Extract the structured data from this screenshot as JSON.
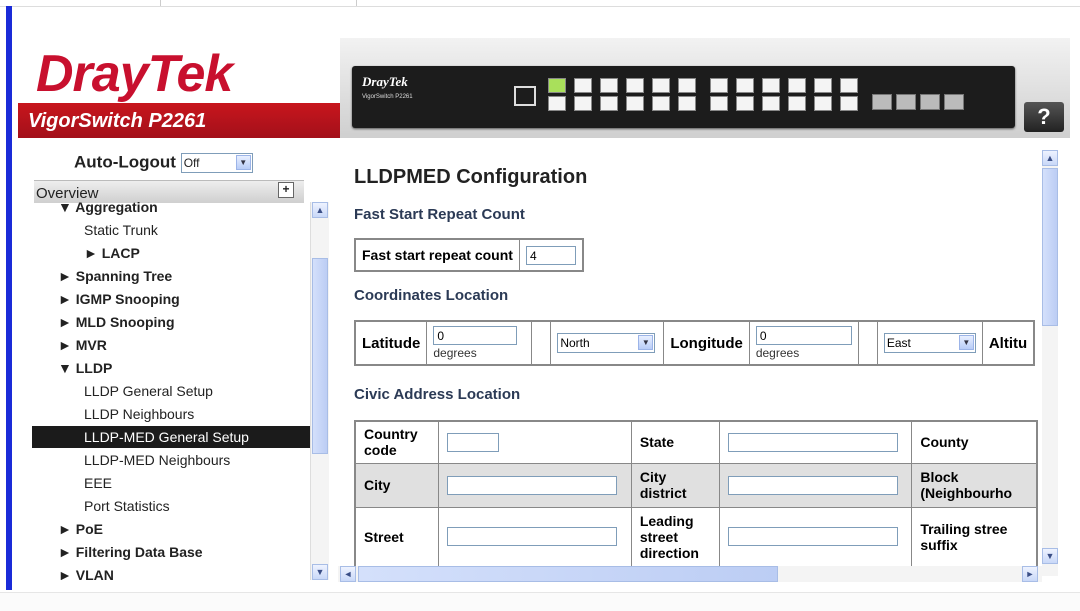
{
  "header": {
    "logo_dray": "Dray",
    "logo_tek": "Tek",
    "model": "VigorSwitch P2261",
    "device_brand": "DrayTek",
    "device_sub": "VigorSwitch P2261",
    "help_label": "?"
  },
  "sidebar": {
    "autologout_label": "Auto-Logout",
    "autologout_value": "Off",
    "overview_label": "Overview",
    "items": [
      {
        "label": "▼ Aggregation",
        "level": "l1"
      },
      {
        "label": "Static Trunk",
        "level": "l2"
      },
      {
        "label": "► LACP",
        "level": "l2b"
      },
      {
        "label": "► Spanning Tree",
        "level": "l1"
      },
      {
        "label": "► IGMP Snooping",
        "level": "l1"
      },
      {
        "label": "► MLD Snooping",
        "level": "l1"
      },
      {
        "label": "► MVR",
        "level": "l1"
      },
      {
        "label": "▼ LLDP",
        "level": "l1"
      },
      {
        "label": "LLDP General Setup",
        "level": "l2"
      },
      {
        "label": "LLDP Neighbours",
        "level": "l2"
      },
      {
        "label": "LLDP-MED General Setup",
        "level": "l2",
        "selected": true
      },
      {
        "label": "LLDP-MED Neighbours",
        "level": "l2"
      },
      {
        "label": "EEE",
        "level": "l2"
      },
      {
        "label": "Port Statistics",
        "level": "l2"
      },
      {
        "label": "► PoE",
        "level": "l1"
      },
      {
        "label": "► Filtering Data Base",
        "level": "l1"
      },
      {
        "label": "► VLAN",
        "level": "l1"
      }
    ]
  },
  "main": {
    "title": "LLDPMED Configuration",
    "fast_start": {
      "section": "Fast Start Repeat Count",
      "label": "Fast start repeat count",
      "value": "4"
    },
    "coordinates": {
      "section": "Coordinates Location",
      "latitude_label": "Latitude",
      "latitude_value": "0",
      "latitude_unit": "degrees",
      "latitude_dir": "North",
      "longitude_label": "Longitude",
      "longitude_value": "0",
      "longitude_unit": "degrees",
      "longitude_dir": "East",
      "altitude_label": "Altitu"
    },
    "civic": {
      "section": "Civic Address Location",
      "country_code": "Country code",
      "state": "State",
      "county": "County",
      "city": "City",
      "city_district": "City district",
      "block": "Block (Neighbourho",
      "street": "Street",
      "leading_street_direction": "Leading street direction",
      "trailing_street_suffix": "Trailing stree suffix"
    }
  },
  "colors": {
    "brand_red": "#c8102e",
    "nav_selected_bg": "#1b1b1b",
    "frame_blue": "#1a2bd8"
  }
}
